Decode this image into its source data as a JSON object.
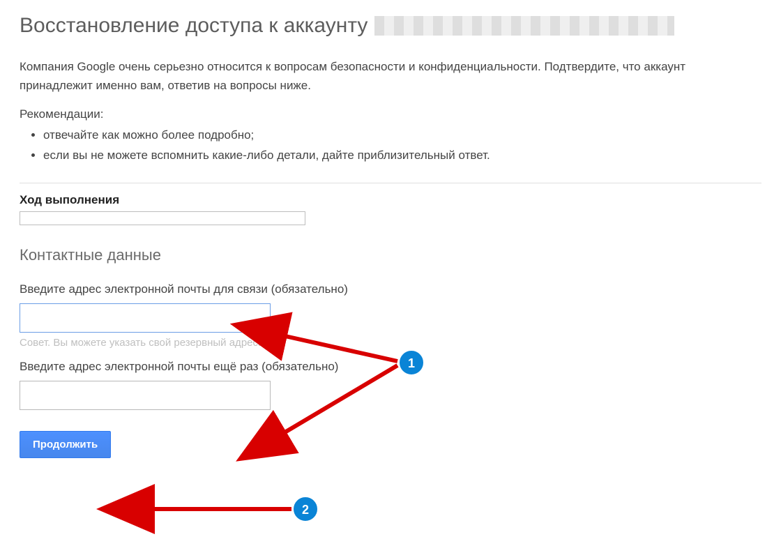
{
  "header": {
    "title": "Восстановление доступа к аккаунту"
  },
  "intro": {
    "paragraph": "Компания Google очень серьезно относится к вопросам безопасности и конфиденциальности. Подтвердите, что аккаунт принадлежит именно вам, ответив на вопросы ниже.",
    "recommend_label": "Рекомендации:",
    "recommend_items": [
      "отвечайте как можно более подробно;",
      "если вы не можете вспомнить какие-либо детали, дайте приблизительный ответ."
    ]
  },
  "progress": {
    "label": "Ход выполнения"
  },
  "contact": {
    "heading": "Контактные данные",
    "email_label": "Введите адрес электронной почты для связи (обязательно)",
    "email_value": "",
    "email_hint": "Совет. Вы можете указать свой резервный адрес.",
    "email_confirm_label": "Введите адрес электронной почты ещё раз (обязательно)",
    "email_confirm_value": ""
  },
  "actions": {
    "continue_label": "Продолжить"
  },
  "annotations": {
    "markers": [
      "1",
      "2"
    ]
  }
}
